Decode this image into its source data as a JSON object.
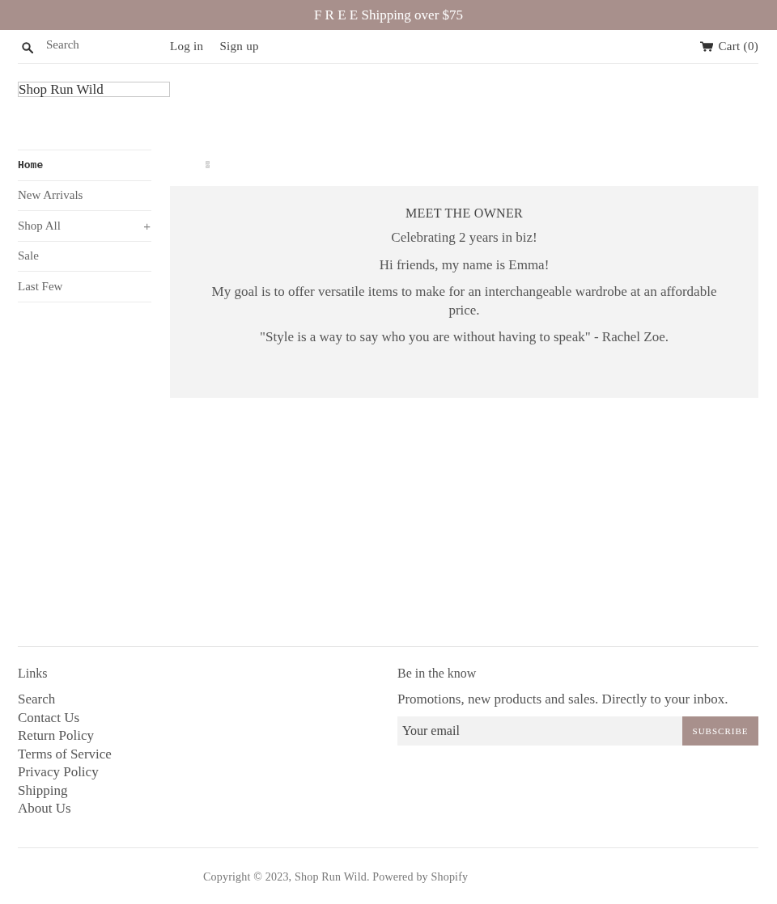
{
  "announcement": {
    "text": "F R E E Shipping over $75"
  },
  "header": {
    "search": {
      "placeholder": "Search"
    },
    "account_links": [
      "Log in",
      "Sign up"
    ],
    "cart": {
      "label": "Cart (0)"
    }
  },
  "logo": {
    "text": "Shop Run Wild"
  },
  "sidebar": {
    "items": [
      {
        "label": "Home",
        "selected": true
      },
      {
        "label": "New Arrivals",
        "selected": false
      },
      {
        "label": "Shop All",
        "selected": false,
        "toggle": "+"
      },
      {
        "label": "Sale",
        "selected": false
      },
      {
        "label": "Last Few",
        "selected": false
      }
    ]
  },
  "main": {
    "section": {
      "title": "MEET THE OWNER",
      "paragraphs": [
        "Celebrating 2 years in biz!",
        "Hi friends, my name is Emma!",
        "My goal is to offer versatile items to make for an interchangeable wardrobe at an affordable price.",
        "\"Style is a way to say who you are without having to speak\" - Rachel Zoe."
      ]
    }
  },
  "footer": {
    "links": {
      "title": "Links",
      "items": [
        "Search",
        "Contact Us",
        "Return Policy",
        "Terms of Service",
        "Privacy Policy",
        "Shipping",
        "About Us"
      ]
    },
    "newsletter": {
      "title": "Be in the know",
      "text": "Promotions, new products and sales. Directly to your inbox.",
      "email": {
        "placeholder": "Your email"
      },
      "button": "SUBSCRIBE"
    },
    "copyright": "Copyright © 2023, Shop Run Wild. Powered by Shopify"
  }
}
